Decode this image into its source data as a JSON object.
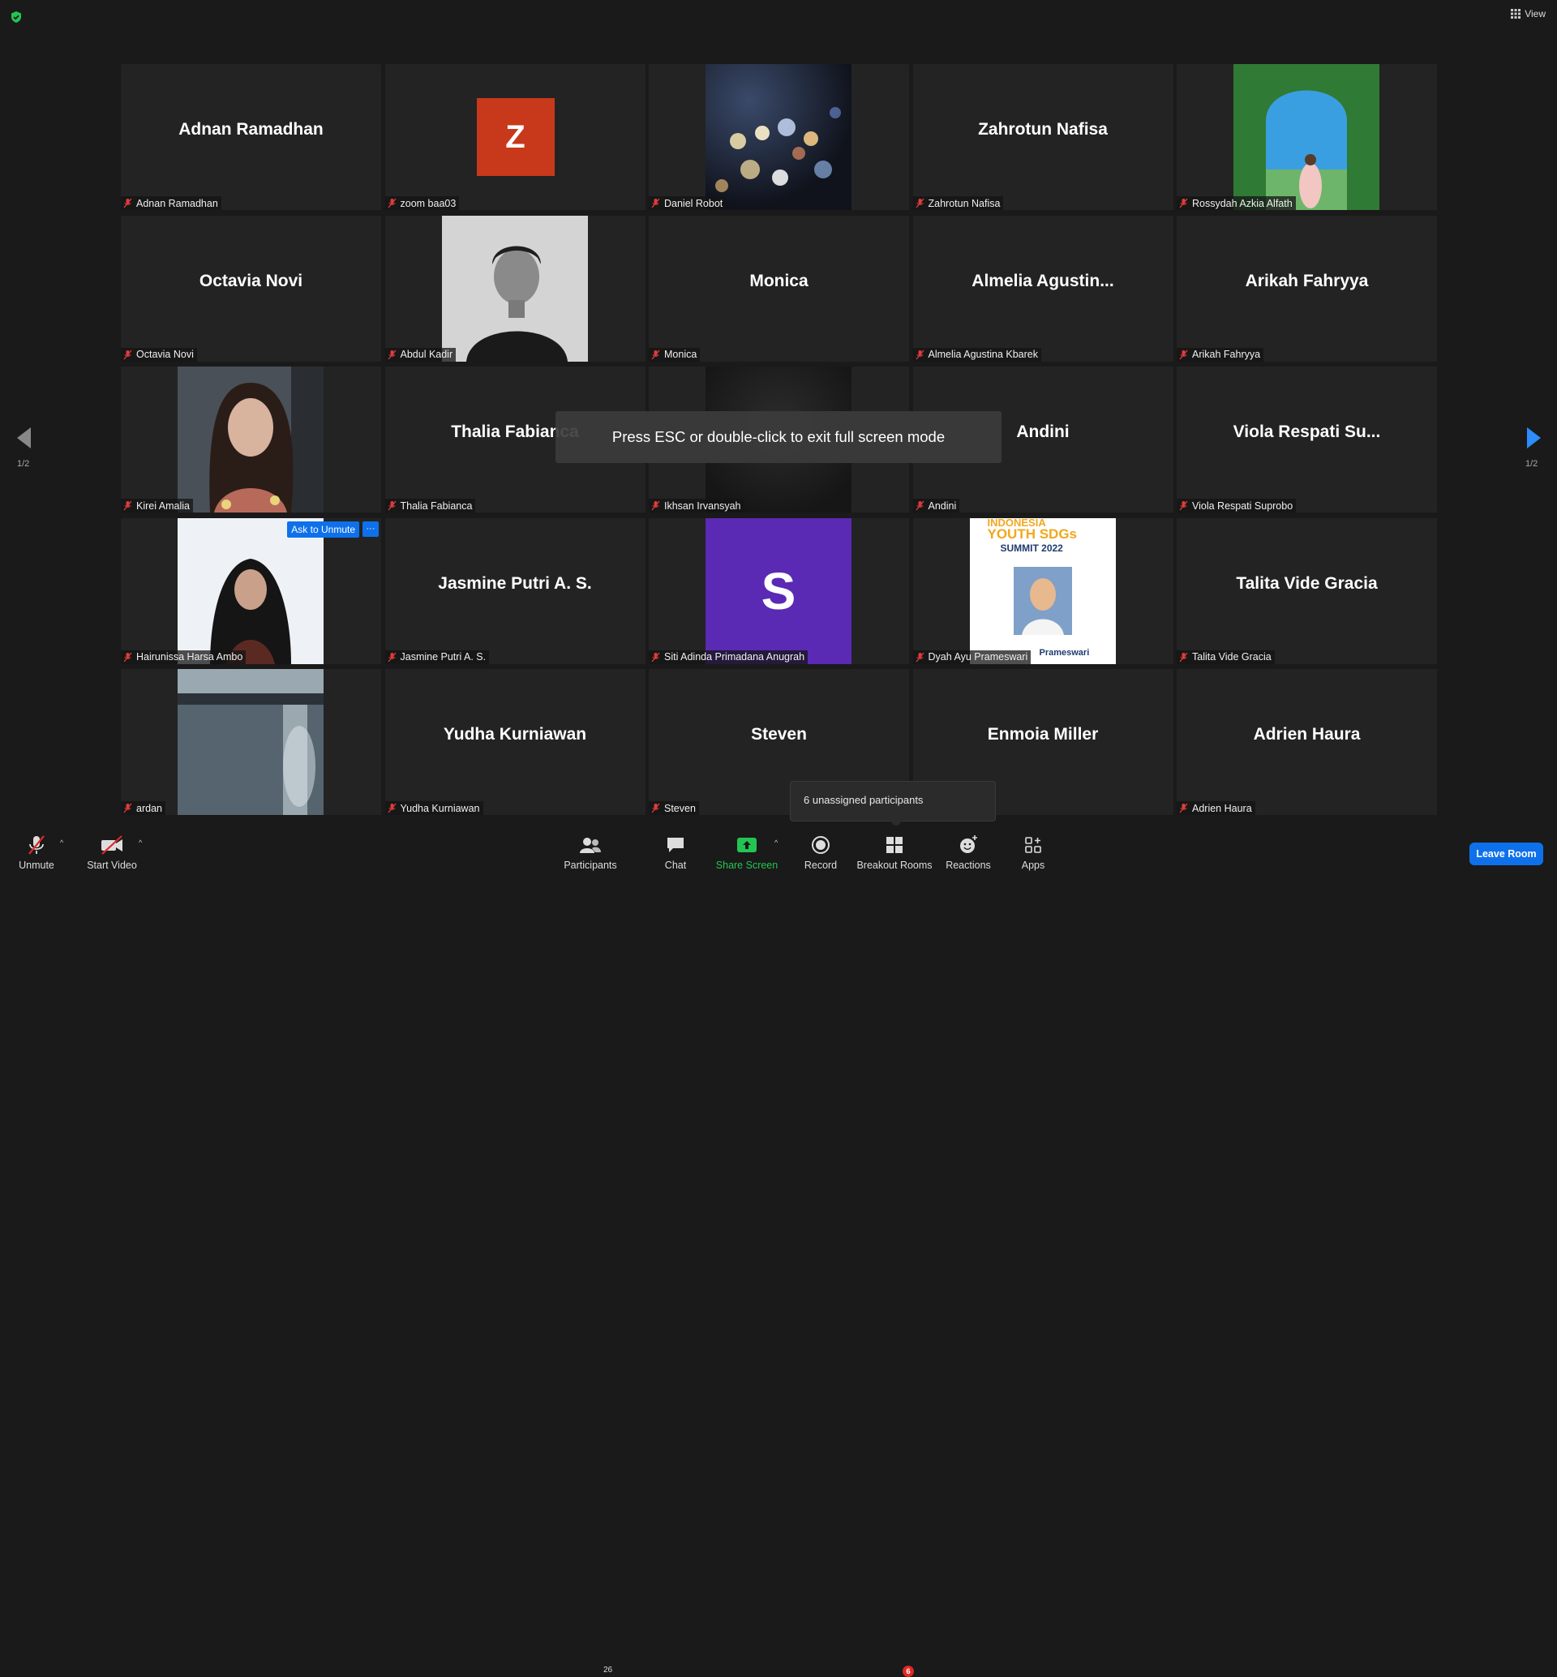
{
  "top": {
    "view_label": "View"
  },
  "tiles": [
    {
      "display": "Adnan Ramadhan",
      "name": "Adnan Ramadhan"
    },
    {
      "display": "Z",
      "name": "zoom baa03"
    },
    {
      "display": "",
      "name": "Daniel Robot"
    },
    {
      "display": "Zahrotun Nafisa",
      "name": "Zahrotun Nafisa"
    },
    {
      "display": "",
      "name": "Rossydah Azkia Alfath"
    },
    {
      "display": "Octavia Novi",
      "name": "Octavia Novi"
    },
    {
      "display": "",
      "name": "Abdul Kadir"
    },
    {
      "display": "Monica",
      "name": "Monica"
    },
    {
      "display": "Almelia  Agustin...",
      "name": "Almelia Agustina Kbarek"
    },
    {
      "display": "Arikah Fahryya",
      "name": "Arikah Fahryya"
    },
    {
      "display": "",
      "name": "Kirei Amalia"
    },
    {
      "display": "Thalia Fabianca",
      "name": "Thalia Fabianca"
    },
    {
      "display": "",
      "name": "Ikhsan Irvansyah"
    },
    {
      "display": "Andini",
      "name": "Andini"
    },
    {
      "display": "Viola  Respati  Su...",
      "name": "Viola Respati Suprobo"
    },
    {
      "display": "",
      "name": "Hairunissa Harsa Ambo",
      "ask_unmute": "Ask to Unmute",
      "more": "···"
    },
    {
      "display": "Jasmine Putri A. S.",
      "name": "Jasmine Putri A. S."
    },
    {
      "display": "S",
      "name": "Siti Adinda Primadana Anugrah"
    },
    {
      "display": "",
      "name": "Dyah Ayu Prameswari",
      "poster_line1": "INDONESIA",
      "poster_line2": "YOUTH SDGs",
      "poster_line3": "SUMMIT 2022",
      "poster_caption": "Prameswari"
    },
    {
      "display": "Talita Vide Gracia",
      "name": "Talita Vide Gracia"
    },
    {
      "display": "",
      "name": "ardan"
    },
    {
      "display": "Yudha Kurniawan",
      "name": "Yudha Kurniawan"
    },
    {
      "display": "Steven",
      "name": "Steven"
    },
    {
      "display": "Enmoia Miller",
      "name": "Enmoia Miller"
    },
    {
      "display": "Adrien Haura",
      "name": "Adrien Haura"
    }
  ],
  "overlay": {
    "esc_text": "Press ESC or double-click to exit full screen mode"
  },
  "pagination": {
    "left": "1/2",
    "right": "1/2"
  },
  "unassigned_text": "6 unassigned participants",
  "toolbar": {
    "unmute": "Unmute",
    "start_video": "Start Video",
    "participants": "Participants",
    "participants_count": "26",
    "chat": "Chat",
    "share_screen": "Share Screen",
    "record": "Record",
    "breakout_rooms": "Breakout Rooms",
    "breakout_badge": "6",
    "reactions": "Reactions",
    "apps": "Apps",
    "leave_room": "Leave Room"
  },
  "colors": {
    "accent": "#0e71eb",
    "share_green": "#23c552",
    "badge_red": "#e02828",
    "z_avatar": "#c8381a",
    "s_avatar": "#5a2ab4"
  }
}
